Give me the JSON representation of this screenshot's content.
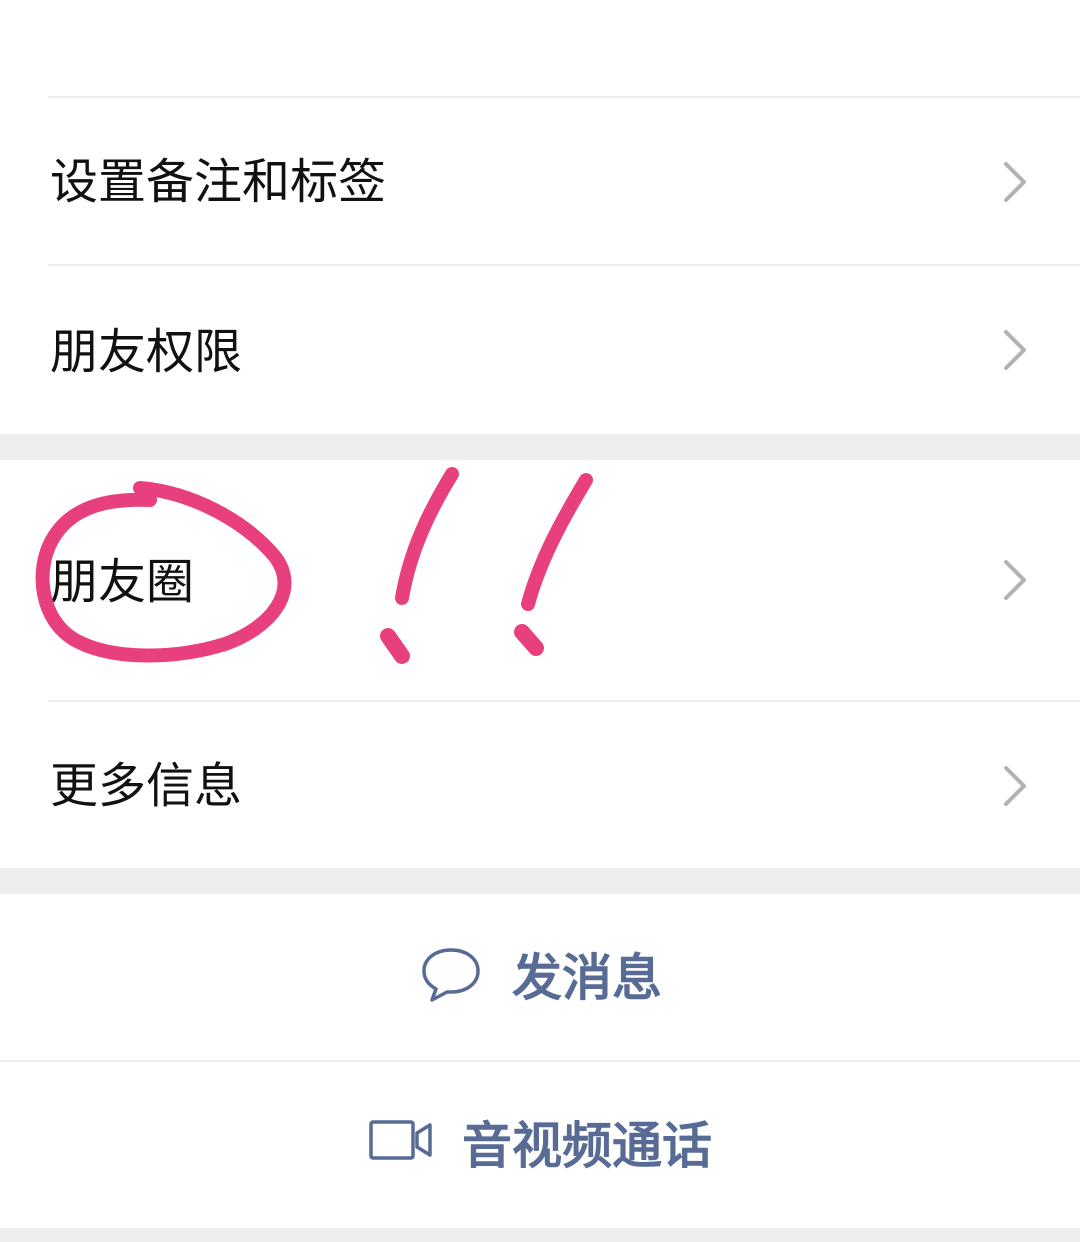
{
  "contact_menu": {
    "remark_tags": "设置备注和标签",
    "friend_permissions": "朋友权限",
    "moments": "朋友圈",
    "more_info": "更多信息"
  },
  "actions": {
    "send_message": "发消息",
    "video_call": "音视频通话"
  },
  "icons": {
    "chevron": "chevron-right-icon",
    "message": "chat-bubble-icon",
    "video": "video-camera-icon"
  },
  "colors": {
    "link_blue": "#576b95",
    "annotation_pink": "#e8407e",
    "chevron_gray": "#b2b2b2",
    "separator_gray": "#ededed"
  }
}
